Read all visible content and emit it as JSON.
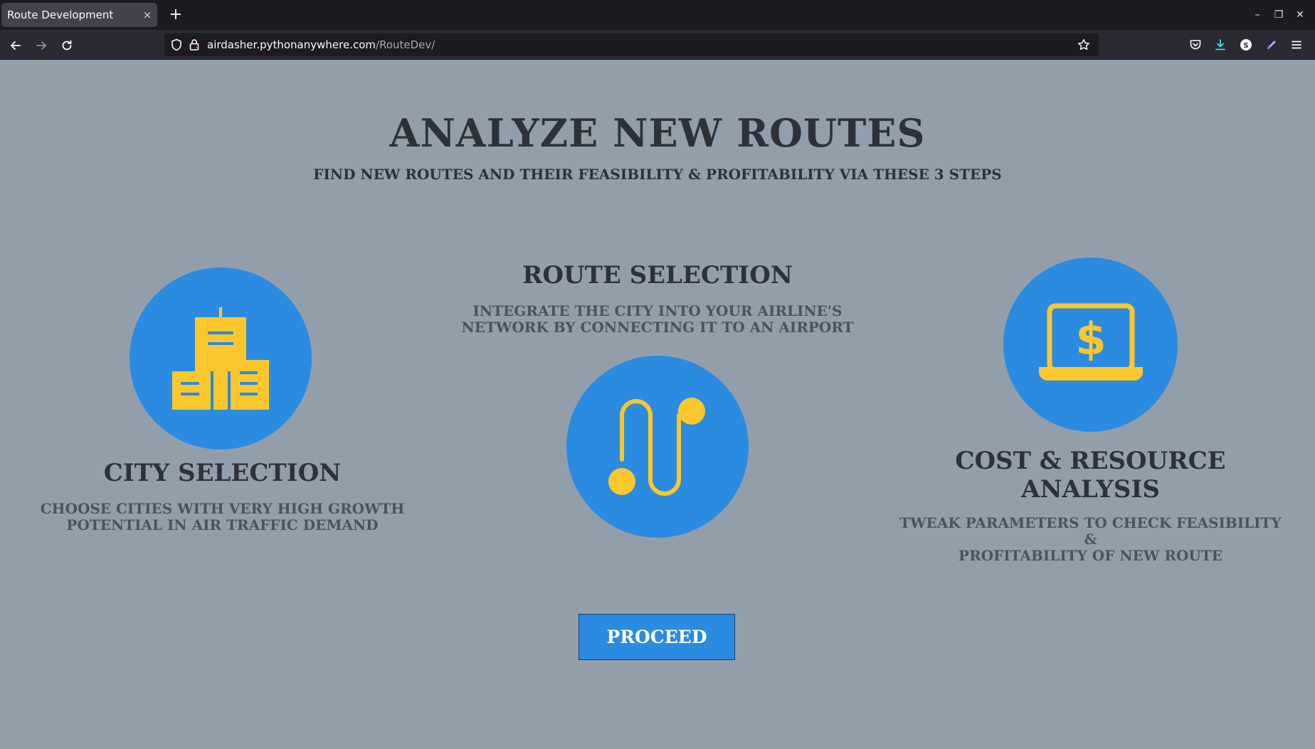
{
  "browser": {
    "tab_title": "Route Development",
    "tab_close": "×",
    "new_tab": "+",
    "url_host": "airdasher.pythonanywhere.com",
    "url_path": "/RouteDev/",
    "window_controls": {
      "minimize": "–",
      "restore": "❐",
      "close": "✕"
    },
    "toolbar_icons": [
      "pocket-icon",
      "download-icon",
      "account-icon",
      "extension-pen-icon",
      "menu-icon"
    ]
  },
  "page": {
    "title": "ANALYZE NEW ROUTES",
    "subtitle": "FIND NEW ROUTES AND THEIR FEASIBILITY & PROFITABILITY VIA THESE 3 STEPS",
    "steps": [
      {
        "title": "CITY SELECTION",
        "description_line1": "CHOOSE CITIES WITH VERY HIGH GROWTH",
        "description_line2": "POTENTIAL IN AIR TRAFFIC DEMAND",
        "icon": "city-buildings-icon"
      },
      {
        "title": "ROUTE SELECTION",
        "description_line1": "INTEGRATE THE CITY INTO YOUR AIRLINE'S",
        "description_line2": "NETWORK BY CONNECTING IT TO AN AIRPORT",
        "icon": "route-path-icon"
      },
      {
        "title_line1": "COST & RESOURCE",
        "title_line2": "ANALYSIS",
        "description_line1": "TWEAK PARAMETERS TO CHECK FEASIBILITY &",
        "description_line2": "PROFITABILITY OF NEW ROUTE",
        "icon": "laptop-dollar-icon"
      }
    ],
    "proceed_label": "PROCEED"
  },
  "colors": {
    "page_bg": "#929fab",
    "accent_blue": "#2b8be0",
    "icon_yellow": "#fcc72c",
    "heading_text": "#2c3238"
  }
}
